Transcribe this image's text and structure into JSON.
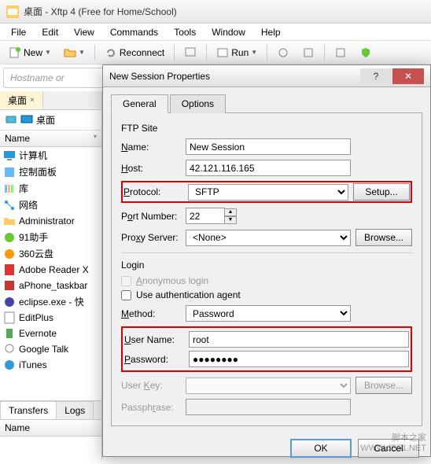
{
  "titlebar": {
    "title": "桌面 - Xftp 4 (Free for Home/School)"
  },
  "menubar": {
    "file": "File",
    "edit": "Edit",
    "view": "View",
    "commands": "Commands",
    "tools": "Tools",
    "window": "Window",
    "help": "Help"
  },
  "toolbar": {
    "new": "New",
    "reconnect": "Reconnect",
    "run": "Run"
  },
  "addressbar": {
    "placeholder": "Hostname or"
  },
  "left": {
    "tab": "桌面",
    "path": "桌面",
    "col_name": "Name",
    "items": [
      "计算机",
      "控制面板",
      "库",
      "网络",
      "Administrator",
      "91助手",
      "360云盘",
      "Adobe Reader X",
      "aPhone_taskbar",
      "eclipse.exe - 快",
      "EditPlus",
      "Evernote",
      "Google Talk",
      "iTunes"
    ],
    "bottom_tabs": {
      "transfers": "Transfers",
      "logs": "Logs"
    },
    "bottom_col": "Name"
  },
  "dialog": {
    "title": "New Session Properties",
    "tabs": {
      "general": "General",
      "options": "Options"
    },
    "ftp_site": {
      "legend": "FTP Site",
      "name_label": "Name:",
      "name_value": "New Session",
      "host_label": "Host:",
      "host_value": "42.121.116.165",
      "protocol_label": "Protocol:",
      "protocol_value": "SFTP",
      "setup_btn": "Setup...",
      "port_label": "Port Number:",
      "port_value": "22",
      "proxy_label": "Proxy Server:",
      "proxy_value": "<None>",
      "browse_btn": "Browse..."
    },
    "login": {
      "legend": "Login",
      "anonymous": "Anonymous login",
      "auth_agent": "Use authentication agent",
      "method_label": "Method:",
      "method_value": "Password",
      "user_label": "User Name:",
      "user_value": "root",
      "pass_label": "Password:",
      "pass_value": "●●●●●●●●",
      "userkey_label": "User Key:",
      "browse2_btn": "Browse...",
      "passphrase_label": "Passphrase:"
    },
    "footer": {
      "ok": "OK",
      "cancel": "Cancel"
    }
  },
  "watermark": {
    "line1": "脚本之家",
    "line2": "WWW.JB51.NET"
  }
}
